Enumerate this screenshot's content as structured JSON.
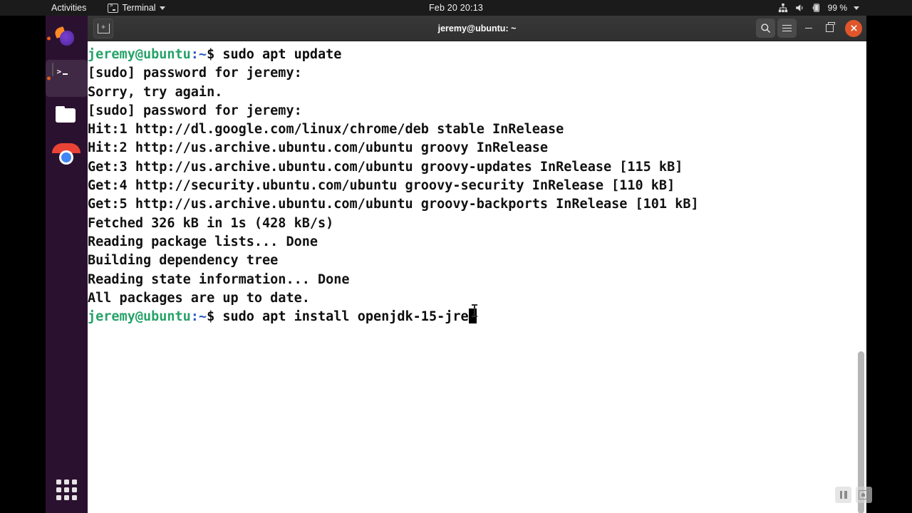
{
  "desktop": {
    "panel": {
      "activities_label": "Activities",
      "app_menu_label": "Terminal",
      "app_menu_icon": "terminal-icon",
      "clock": "Feb 20  20:13",
      "status_icons": [
        "network-wired-icon",
        "volume-icon",
        "battery-icon"
      ],
      "battery_percent": "99 %",
      "dropdown_icon": "chevron-down-icon",
      "background": "#1b1b1b"
    },
    "dock": {
      "background": "#2b1130",
      "items": [
        {
          "name": "firefox",
          "label": "Firefox",
          "running": true,
          "active": false
        },
        {
          "name": "terminal",
          "label": "Terminal",
          "running": true,
          "active": true
        },
        {
          "name": "files",
          "label": "Files",
          "running": false,
          "active": false
        },
        {
          "name": "chrome",
          "label": "Google Chrome",
          "running": false,
          "active": false
        }
      ],
      "show_apps_label": "Show Applications",
      "show_apps_icon": "app-grid-icon"
    },
    "overlay": {
      "buttons": [
        {
          "name": "pause",
          "icon": "pause-icon"
        },
        {
          "name": "screenshot",
          "icon": "screenshot-icon"
        }
      ]
    }
  },
  "terminal": {
    "title": "jeremy@ubuntu: ~",
    "new_tab_icon": "new-tab-icon",
    "titlebar_buttons": [
      {
        "name": "search",
        "icon": "search-icon"
      },
      {
        "name": "menu",
        "icon": "hamburger-menu-icon"
      },
      {
        "name": "minimize",
        "icon": "minimize-icon"
      },
      {
        "name": "maximize",
        "icon": "maximize-icon"
      },
      {
        "name": "close",
        "icon": "close-icon"
      }
    ],
    "colors": {
      "background": "#ffffff",
      "foreground": "#0d0d0d",
      "prompt_user": "#26a269",
      "prompt_path": "#2a59c4",
      "titlebar": "#333333",
      "close_button": "#e0562a"
    },
    "prompt": {
      "user_host": "jeremy@ubuntu",
      "path": ":~",
      "sigil": "$"
    },
    "lines": [
      {
        "type": "prompt",
        "command": " sudo apt update"
      },
      {
        "type": "out",
        "text": "[sudo] password for jeremy:"
      },
      {
        "type": "out",
        "text": "Sorry, try again."
      },
      {
        "type": "out",
        "text": "[sudo] password for jeremy:"
      },
      {
        "type": "out",
        "text": "Hit:1 http://dl.google.com/linux/chrome/deb stable InRelease"
      },
      {
        "type": "out",
        "text": "Hit:2 http://us.archive.ubuntu.com/ubuntu groovy InRelease"
      },
      {
        "type": "out",
        "text": "Get:3 http://us.archive.ubuntu.com/ubuntu groovy-updates InRelease [115 kB]"
      },
      {
        "type": "out",
        "text": "Get:4 http://security.ubuntu.com/ubuntu groovy-security InRelease [110 kB]"
      },
      {
        "type": "out",
        "text": "Get:5 http://us.archive.ubuntu.com/ubuntu groovy-backports InRelease [101 kB]"
      },
      {
        "type": "out",
        "text": "Fetched 326 kB in 1s (428 kB/s)"
      },
      {
        "type": "out",
        "text": "Reading package lists... Done"
      },
      {
        "type": "out",
        "text": "Building dependency tree"
      },
      {
        "type": "out",
        "text": "Reading state information... Done"
      },
      {
        "type": "out",
        "text": "All packages are up to date."
      },
      {
        "type": "prompt",
        "command": " sudo apt install openjdk-15-jre",
        "cursor": true
      }
    ]
  }
}
